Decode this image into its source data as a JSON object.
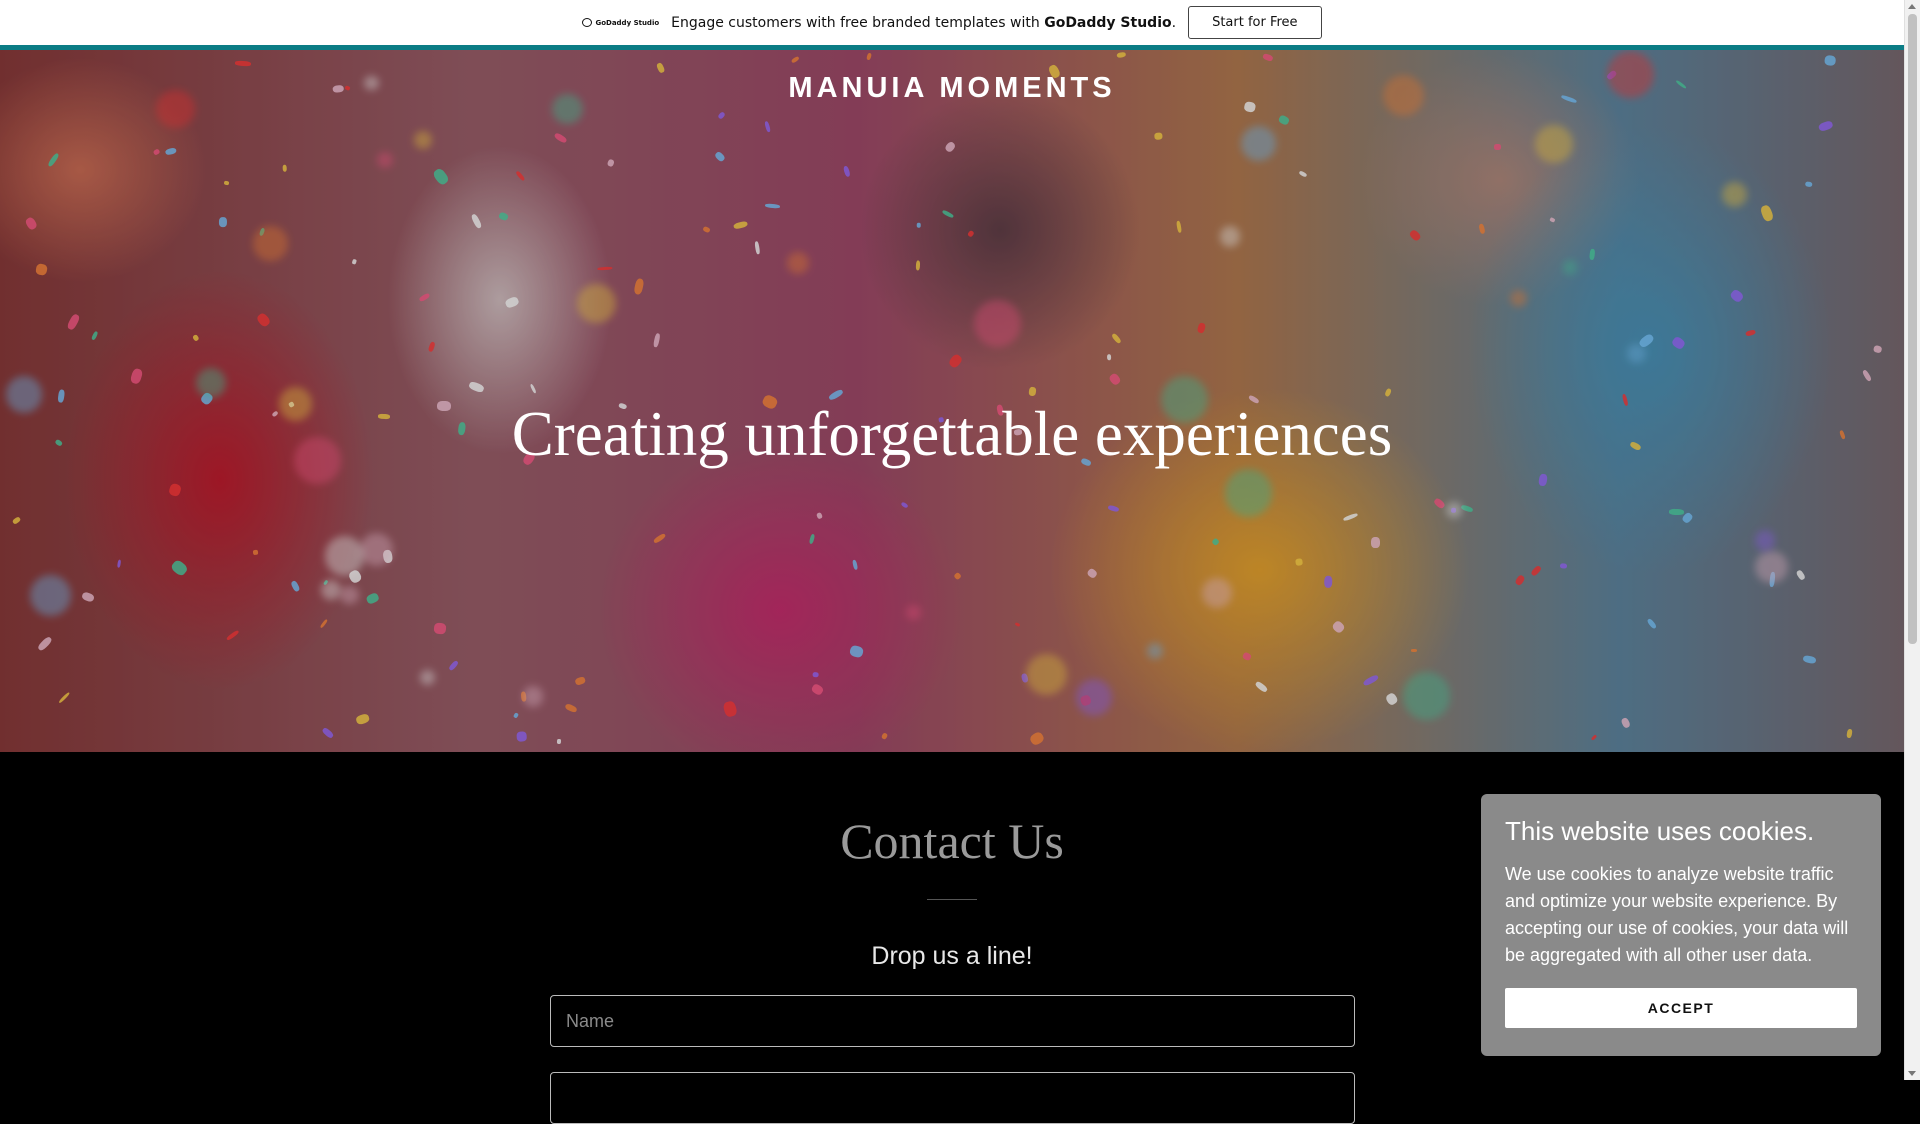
{
  "promo_bar": {
    "logo_text": "GoDaddy Studio",
    "message_prefix": "Engage customers with free branded templates with ",
    "message_brand": "GoDaddy Studio",
    "message_suffix": ".",
    "cta_label": "Start for Free",
    "accent_color": "#0b7c85"
  },
  "hero": {
    "brand_name": "MANUIA MOMENTS",
    "tagline": "Creating unforgettable experiences"
  },
  "contact": {
    "heading": "Contact Us",
    "subheading": "Drop us a line!",
    "name_placeholder": "Name"
  },
  "cookie_banner": {
    "title": "This website uses cookies.",
    "body": "We use cookies to analyze website traffic and optimize your website experience. By accepting our use of cookies, your data will be aggregated with all other user data.",
    "accept_label": "ACCEPT"
  },
  "icons": {
    "promo_logo": "godaddy-logo-icon"
  }
}
